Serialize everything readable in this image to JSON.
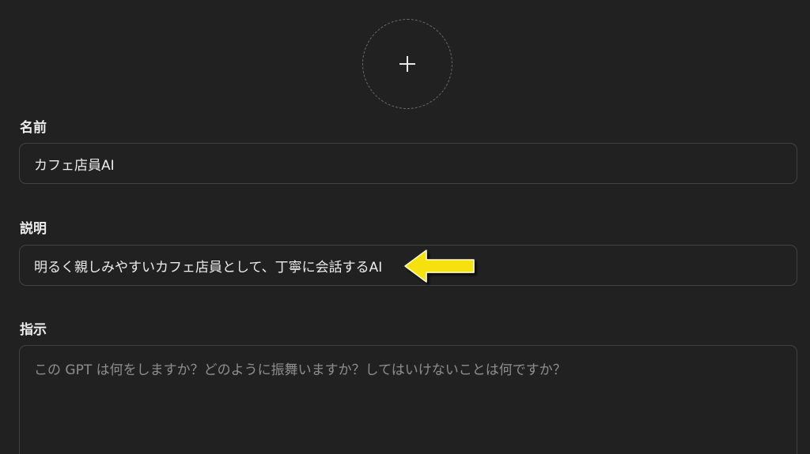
{
  "avatar": {
    "icon": "plus-icon"
  },
  "fields": {
    "name": {
      "label": "名前",
      "value": "カフェ店員AI"
    },
    "description": {
      "label": "説明",
      "value": "明るく親しみやすいカフェ店員として、丁寧に会話するAI"
    },
    "instructions": {
      "label": "指示",
      "placeholder": "この GPT は何をしますか？どのように振舞いますか？してはいけないことは何ですか？"
    }
  },
  "annotation": {
    "icon": "yellow-arrow-icon",
    "color": "#f5e10a"
  }
}
